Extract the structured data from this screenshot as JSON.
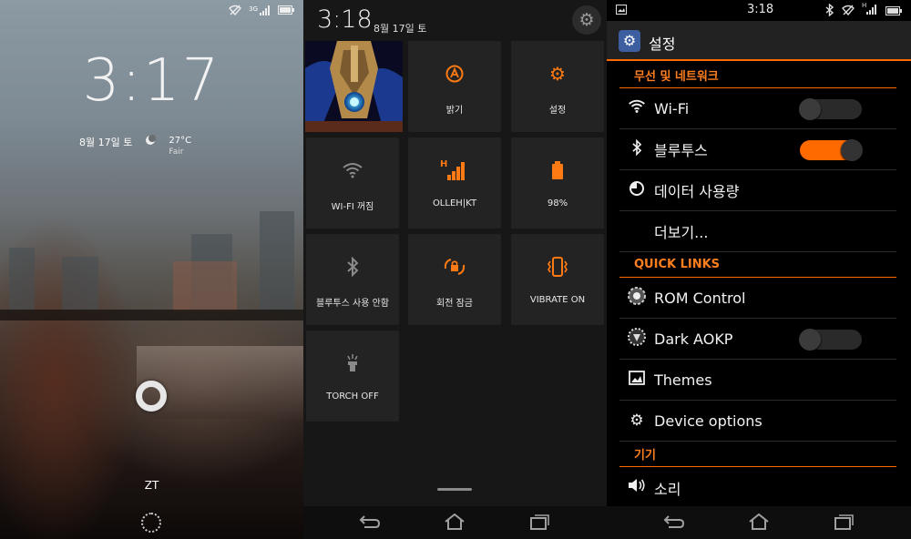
{
  "lockscreen": {
    "time": "3:17",
    "date": "8월 17일 토",
    "temperature": "27°C",
    "condition": "Fair",
    "owner": "ZT",
    "status_network": "3G"
  },
  "quick_settings": {
    "time": "3:18",
    "date": "8월 17일 토",
    "tiles": [
      {
        "label": "밝기",
        "icon": "auto-brightness-icon"
      },
      {
        "label": "설정",
        "icon": "settings-gear-icon"
      },
      {
        "label": "WI-FI 꺼짐",
        "icon": "wifi-icon"
      },
      {
        "label": "OLLEH|KT",
        "icon": "signal-icon",
        "network": "H"
      },
      {
        "label": "98%",
        "icon": "battery-icon"
      },
      {
        "label": "블루투스 사용 안함",
        "icon": "bluetooth-icon"
      },
      {
        "label": "회전 잠금",
        "icon": "rotation-lock-icon"
      },
      {
        "label": "VIBRATE ON",
        "icon": "vibrate-icon"
      },
      {
        "label": "TORCH OFF",
        "icon": "torch-icon"
      }
    ]
  },
  "settings": {
    "status_time": "3:18",
    "status_network": "H",
    "title": "설정",
    "sections": [
      {
        "header": "무선 및 네트워크"
      },
      {
        "header": "QUICK LINKS"
      },
      {
        "header": "기기"
      }
    ],
    "rows": {
      "wifi": {
        "label": "Wi-Fi",
        "toggle": "off"
      },
      "bluetooth": {
        "label": "블루투스",
        "toggle": "on"
      },
      "data_usage": {
        "label": "데이터 사용량"
      },
      "more": {
        "label": "더보기..."
      },
      "rom_control": {
        "label": "ROM Control"
      },
      "dark_aokp": {
        "label": "Dark AOKP",
        "toggle": "off"
      },
      "themes": {
        "label": "Themes"
      },
      "device_options": {
        "label": "Device options"
      },
      "sound": {
        "label": "소리"
      }
    }
  },
  "colors": {
    "accent": "#ff6a00",
    "tile_bg": "#232323",
    "panel_bg": "#171717"
  }
}
